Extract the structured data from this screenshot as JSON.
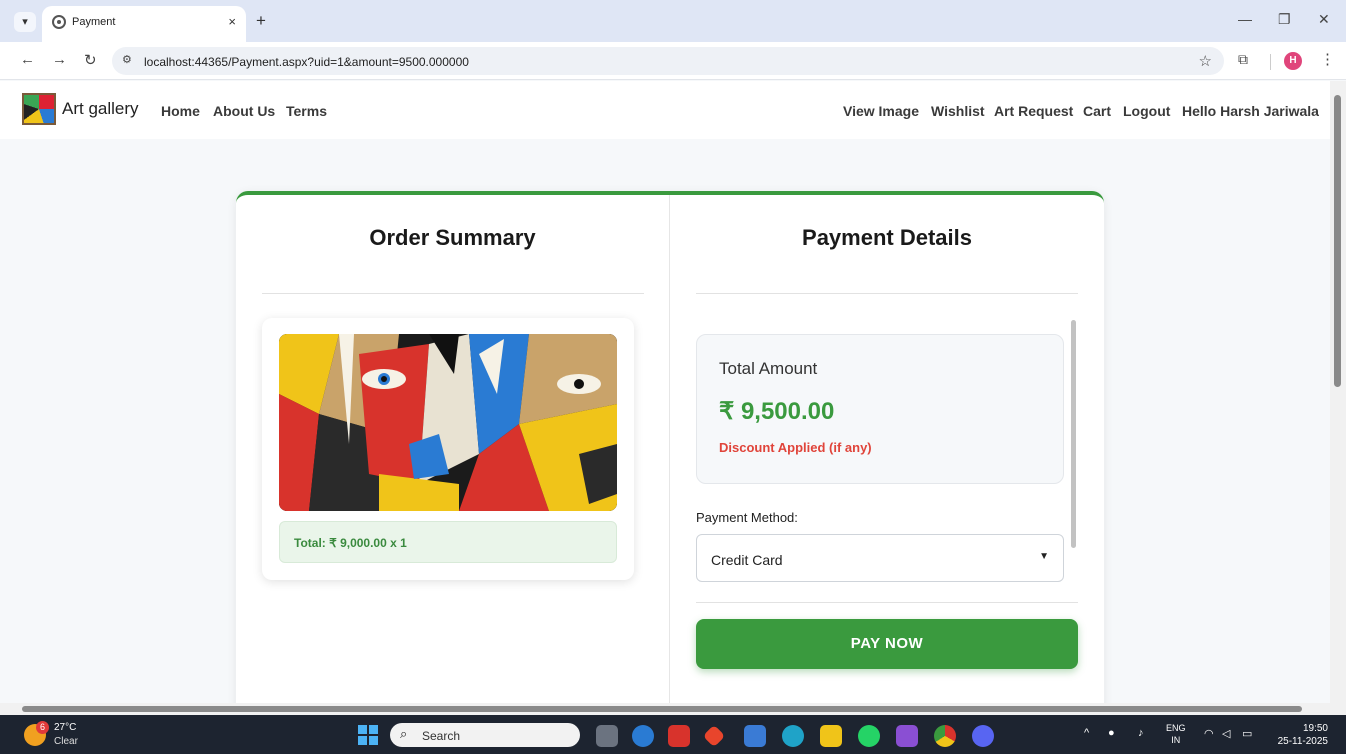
{
  "browser": {
    "tab_title": "Payment",
    "url": "localhost:44365/Payment.aspx?uid=1&amount=9500.000000",
    "profile_initial": "H",
    "icons": {
      "tab_search": "▾",
      "close": "×",
      "new_tab": "+",
      "minimize": "—",
      "restore": "❐",
      "close_window": "✕",
      "back": "←",
      "forward": "→",
      "reload": "↻",
      "site_info": "⚙",
      "star": "☆",
      "extensions": "⧉",
      "menu": "⋮"
    }
  },
  "navbar": {
    "brand": "Art gallery",
    "left_links": [
      "Home",
      "About Us",
      "Terms"
    ],
    "right_links": [
      "View Image",
      "Wishlist",
      "Art Request",
      "Cart",
      "Logout",
      "Hello Harsh Jariwala"
    ]
  },
  "order_summary": {
    "title": "Order Summary",
    "item_total": "Total: ₹ 9,000.00 x 1"
  },
  "payment": {
    "title": "Payment Details",
    "total_label": "Total Amount",
    "total_value": "₹ 9,500.00",
    "discount_note": "Discount Applied (if any)",
    "method_label": "Payment Method:",
    "method_selected": "Credit Card",
    "pay_button": "PAY NOW"
  },
  "taskbar": {
    "weather_badge": "6",
    "temperature": "27°C",
    "condition": "Clear",
    "search_placeholder": "Search",
    "lang_line1": "ENG",
    "lang_line2": "IN",
    "time": "19:50",
    "date": "25-11-2025"
  },
  "colors": {
    "accent_green": "#3a9a3e",
    "discount_red": "#e0443a"
  }
}
